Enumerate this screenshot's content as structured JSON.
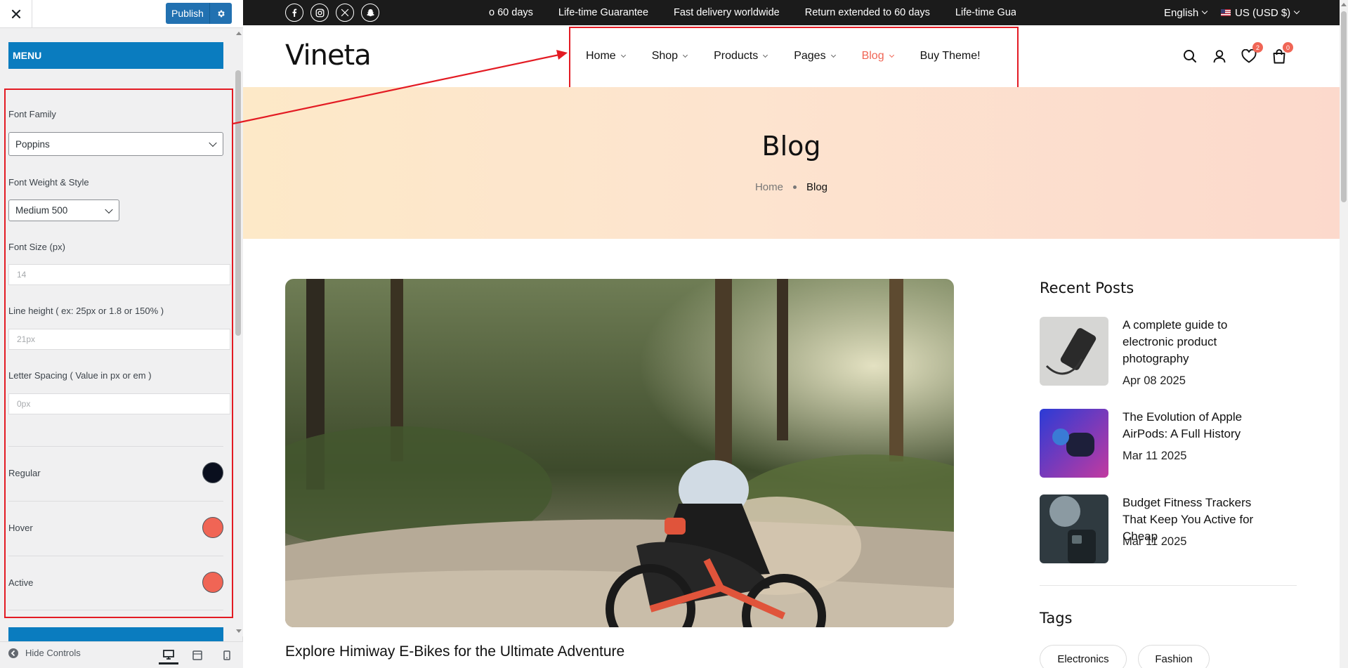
{
  "customizer": {
    "publish_label": "Publish",
    "section_title": "MENU",
    "font_family_label": "Font Family",
    "font_family_value": "Poppins",
    "font_weight_label": "Font Weight & Style",
    "font_weight_value": "Medium 500",
    "font_size_label": "Font Size (px)",
    "font_size_placeholder": "14",
    "line_height_label": "Line height ( ex: 25px or 1.8 or 150% )",
    "line_height_placeholder": "21px",
    "letter_spacing_label": "Letter Spacing ( Value in px or em )",
    "letter_spacing_placeholder": "0px",
    "colors": [
      {
        "label": "Regular",
        "color": "#0a0f1e"
      },
      {
        "label": "Hover",
        "color": "#f06555"
      },
      {
        "label": "Active",
        "color": "#f06555"
      }
    ],
    "hide_controls_label": "Hide Controls"
  },
  "topbar": {
    "socials": [
      "facebook-icon",
      "instagram-icon",
      "x-twitter-icon",
      "snapchat-icon"
    ],
    "announcements": [
      "o 60 days",
      "Life-time Guarantee",
      "Fast delivery worldwide",
      "Return extended to 60 days",
      "Life-time Guara"
    ],
    "language": "English",
    "currency": "US (USD $)"
  },
  "header": {
    "logo": "Vineta",
    "nav": [
      {
        "label": "Home",
        "has_dropdown": true
      },
      {
        "label": "Shop",
        "has_dropdown": true
      },
      {
        "label": "Products",
        "has_dropdown": true
      },
      {
        "label": "Pages",
        "has_dropdown": true
      },
      {
        "label": "Blog",
        "has_dropdown": true,
        "active": true
      },
      {
        "label": "Buy Theme!",
        "has_dropdown": false
      }
    ],
    "wishlist_count": "2",
    "cart_count": "0",
    "accent_color": "#f06555"
  },
  "hero": {
    "title": "Blog",
    "breadcrumb_home": "Home",
    "breadcrumb_current": "Blog"
  },
  "main": {
    "post_title": "Explore Himiway E-Bikes for the Ultimate Adventure"
  },
  "sidebar": {
    "recent_title": "Recent Posts",
    "posts": [
      {
        "title": "A complete guide to electronic product photography",
        "date": "Apr 08 2025"
      },
      {
        "title": "The Evolution of Apple AirPods: A Full History",
        "date": "Mar 11 2025"
      },
      {
        "title": "Budget Fitness Trackers That Keep You Active for Cheap",
        "date": "Mar 11 2025"
      }
    ],
    "tags_title": "Tags",
    "tags": [
      "Electronics",
      "Fashion"
    ]
  }
}
